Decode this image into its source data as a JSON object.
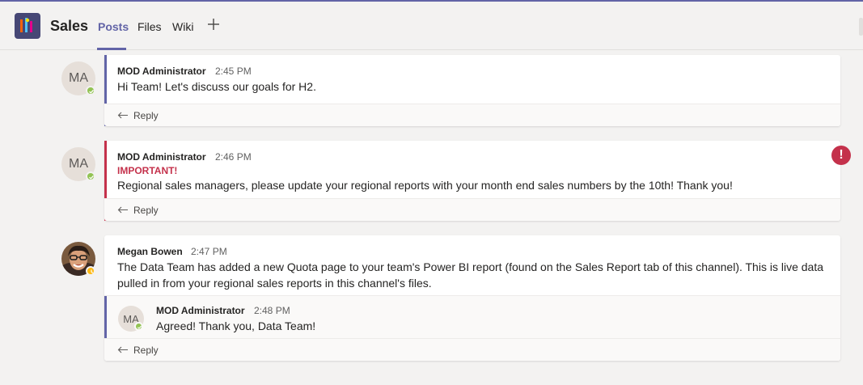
{
  "header": {
    "team_name": "Sales",
    "tabs": [
      {
        "label": "Posts",
        "active": true
      },
      {
        "label": "Files",
        "active": false
      },
      {
        "label": "Wiki",
        "active": false
      }
    ],
    "add_tab_icon": "plus-icon"
  },
  "colors": {
    "accent": "#6264a7",
    "important": "#c4314b",
    "presence_available": "#92c353",
    "presence_away": "#fdb913"
  },
  "messages": [
    {
      "avatar_initials": "MA",
      "presence": "available",
      "author": "MOD Administrator",
      "time": "2:45 PM",
      "text": "Hi Team! Let's discuss our goals for H2.",
      "reply_label": "Reply"
    },
    {
      "avatar_initials": "MA",
      "presence": "available",
      "author": "MOD Administrator",
      "time": "2:46 PM",
      "important_label": "IMPORTANT!",
      "text": "Regional sales managers, please update your regional reports with your month end sales numbers by the 10th! Thank you!",
      "reply_label": "Reply",
      "badge": "!"
    },
    {
      "avatar": "photo",
      "presence": "away",
      "author": "Megan Bowen",
      "time": "2:47 PM",
      "text_line1": "The Data Team has added a new Quota page to your team's Power BI report (found on the Sales Report tab of this channel). This is live data",
      "text_line2": "pulled in from your regional sales reports in this channel's files.",
      "reply": {
        "avatar_initials": "MA",
        "presence": "available",
        "author": "MOD Administrator",
        "time": "2:48 PM",
        "text": "Agreed! Thank you, Data Team!"
      },
      "reply_label": "Reply"
    }
  ]
}
